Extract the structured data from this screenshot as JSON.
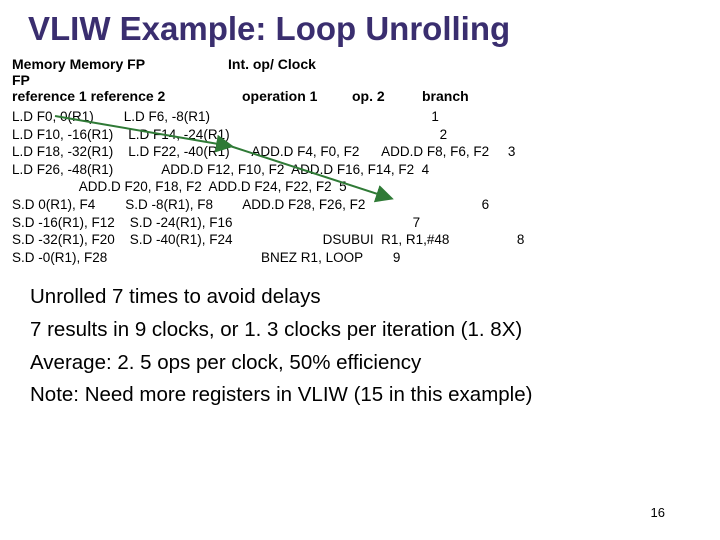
{
  "title": "VLIW Example: Loop Unrolling",
  "headers": {
    "col1": "Memory Memory FP         FP",
    "col2": "reference 1         reference 2",
    "col3": "Int. op/   Clock",
    "col4": "operation 1",
    "col5": "op. 2",
    "col6": "branch"
  },
  "rows": [
    "L.D F0, 0(R1)        L.D F6, -8(R1)                                                           1",
    "L.D F10, -16(R1)    L.D F14, -24(R1)                                                        2",
    "L.D F18, -32(R1)    L.D F22, -40(R1)      ADD.D F4, F0, F2      ADD.D F8, F6, F2     3",
    "L.D F26, -48(R1)             ADD.D F12, F10, F2  ADD.D F16, F14, F2  4",
    "                  ADD.D F20, F18, F2  ADD.D F24, F22, F2  5",
    "S.D 0(R1), F4        S.D -8(R1), F8        ADD.D F28, F26, F2                               6",
    "S.D -16(R1), F12    S.D -24(R1), F16                                                7",
    "S.D -32(R1), F20    S.D -40(R1), F24                        DSUBUI  R1, R1,#48                  8",
    "S.D -0(R1), F28                                         BNEZ R1, LOOP        9"
  ],
  "bullets": [
    "Unrolled 7 times to avoid delays",
    "7 results in 9 clocks, or 1. 3 clocks per iteration (1. 8X)",
    "Average: 2. 5 ops per clock, 50% efficiency",
    "Note: Need more registers in VLIW (15 in this example)"
  ],
  "pagenum": "16",
  "chart_data": {
    "type": "table",
    "title": "VLIW Example: Loop Unrolling",
    "columns": [
      "Memory reference 1",
      "Memory reference 2",
      "FP operation 1",
      "FP op. 2",
      "Int. op/branch",
      "Clock"
    ],
    "rows": [
      [
        "L.D F0, 0(R1)",
        "L.D F6, -8(R1)",
        "",
        "",
        "",
        1
      ],
      [
        "L.D F10, -16(R1)",
        "L.D F14, -24(R1)",
        "",
        "",
        "",
        2
      ],
      [
        "L.D F18, -32(R1)",
        "L.D F22, -40(R1)",
        "ADD.D F4, F0, F2",
        "ADD.D F8, F6, F2",
        "",
        3
      ],
      [
        "L.D F26, -48(R1)",
        "",
        "ADD.D F12, F10, F2",
        "ADD.D F16, F14, F2",
        "",
        4
      ],
      [
        "",
        "",
        "ADD.D F20, F18, F2",
        "ADD.D F24, F22, F2",
        "",
        5
      ],
      [
        "S.D 0(R1), F4",
        "S.D -8(R1), F8",
        "ADD.D F28, F26, F2",
        "",
        "",
        6
      ],
      [
        "S.D -16(R1), F12",
        "S.D -24(R1), F16",
        "",
        "",
        "",
        7
      ],
      [
        "S.D -32(R1), F20",
        "S.D -40(R1), F24",
        "",
        "",
        "DSUBUI R1, R1,#48",
        8
      ],
      [
        "S.D -0(R1), F28",
        "",
        "",
        "",
        "BNEZ R1, LOOP",
        9
      ]
    ]
  }
}
